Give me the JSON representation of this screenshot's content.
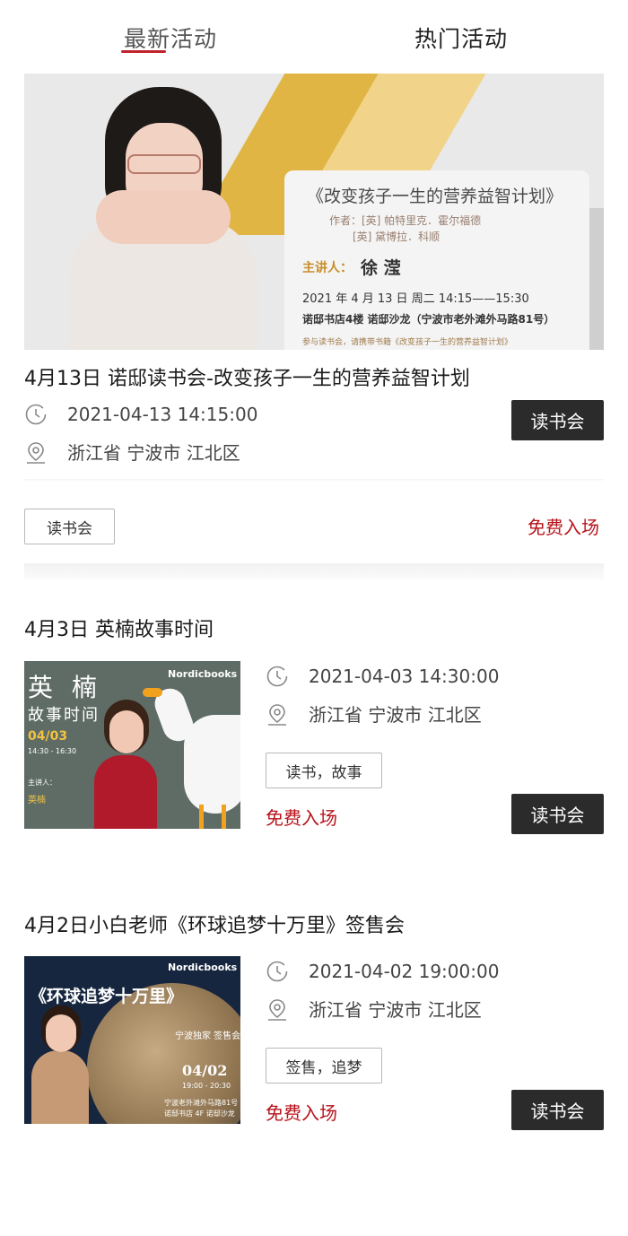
{
  "tabs": {
    "latest": "最新活动",
    "hot": "热门活动"
  },
  "featured": {
    "banner": {
      "book_title": "《改变孩子一生的营养益智计划》",
      "author_line1": "作者：[英] 帕特里克．霍尔福德",
      "author_line2": "[英] 黛博拉．科顺",
      "speaker_label": "主讲人：",
      "speaker_name": "徐  滢",
      "time": "2021 年 4 月 13 日 周二  14:15——15:30",
      "place": "诺邸书店4楼 诺邸沙龙（宁波市老外滩外马路81号）",
      "note": "参与读书会，请携带书籍《改变孩子一生的营养益智计划》"
    },
    "title": "4月13日 诺邸读书会-改变孩子一生的营养益智计划",
    "datetime": "2021-04-13 14:15:00",
    "location": "浙江省 宁波市 江北区",
    "category_button": "读书会",
    "tag": "读书会",
    "price": "免费入场"
  },
  "events": [
    {
      "title": "4月3日 英楠故事时间",
      "datetime": "2021-04-03 14:30:00",
      "location": "浙江省 宁波市 江北区",
      "tag": "读书，故事",
      "price": "免费入场",
      "category_button": "读书会",
      "thumb": {
        "headline1": "英  楠",
        "headline2": "故事时间",
        "date": "04/03",
        "time": "14:30 - 16:30",
        "brand": "Nordicbooks",
        "speaker_label": "主讲人：",
        "speaker": "英楠"
      }
    },
    {
      "title": "4月2日小白老师《环球追梦十万里》签售会",
      "datetime": "2021-04-02 19:00:00",
      "location": "浙江省 宁波市 江北区",
      "tag": "签售，追梦",
      "price": "免费入场",
      "category_button": "读书会",
      "thumb": {
        "headline": "《环球追梦十万里》",
        "subtitle": "宁波独家 签售会",
        "date": "04/02",
        "time": "19:00 - 20:30",
        "brand": "Nordicbooks",
        "address": "宁波老外滩外马路81号",
        "venue": "诺邸书店 4F 诺邸沙龙"
      }
    }
  ],
  "colors": {
    "accent_red": "#b8131b",
    "button_dark": "#2b2b2b",
    "tab_underline": "#c0232c"
  },
  "icons": {
    "time": "clock-icon",
    "location": "location-pin-icon"
  }
}
